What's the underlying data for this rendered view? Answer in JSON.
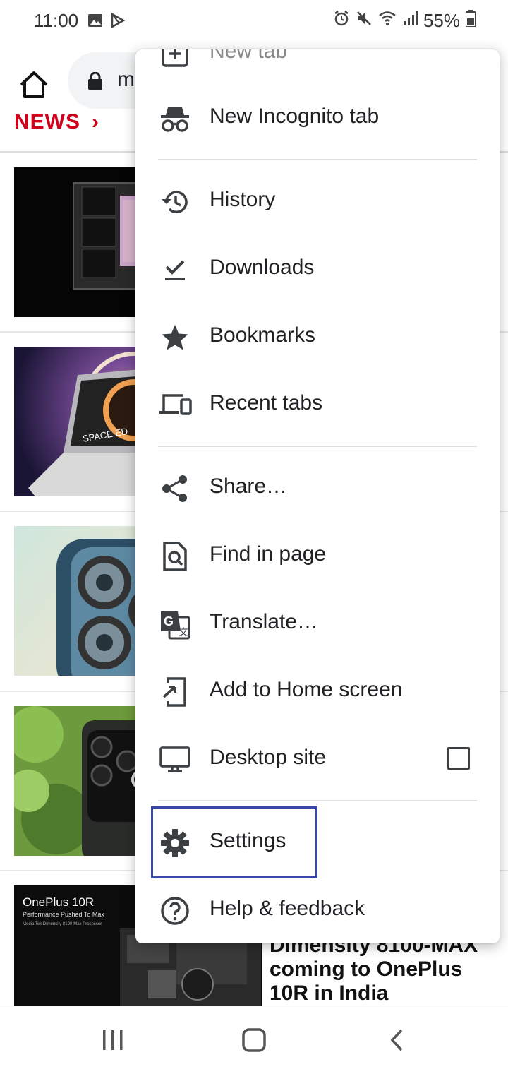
{
  "status_bar": {
    "time": "11:00",
    "battery": "55%",
    "left_icons": [
      "image-notification-icon",
      "play-store-icon"
    ],
    "right_icons": [
      "alarm-icon",
      "mute-icon",
      "wifi-icon",
      "signal-icon",
      "battery-icon"
    ]
  },
  "toolbar": {
    "url_visible": "m"
  },
  "page": {
    "section_title": "NEWS",
    "headline_lines": [
      "Dimensity 8100-MAX",
      "coming to OnePlus",
      "10R in India"
    ],
    "thumb_text": {
      "brand": "OnePlus 10R",
      "tagline": "Performance Pushed To Max",
      "sub": "Media Tek Dimensity 8100-Max Processor",
      "laptop": "SPACE ED"
    }
  },
  "menu": {
    "items": [
      {
        "id": "new-tab",
        "label": "New tab",
        "icon": "new-tab-icon"
      },
      {
        "id": "new-incognito-tab",
        "label": "New Incognito tab",
        "icon": "incognito-icon"
      },
      {
        "id": "history",
        "label": "History",
        "icon": "history-icon"
      },
      {
        "id": "downloads",
        "label": "Downloads",
        "icon": "downloads-icon"
      },
      {
        "id": "bookmarks",
        "label": "Bookmarks",
        "icon": "star-icon"
      },
      {
        "id": "recent-tabs",
        "label": "Recent tabs",
        "icon": "devices-icon"
      },
      {
        "id": "share",
        "label": "Share…",
        "icon": "share-icon"
      },
      {
        "id": "find-in-page",
        "label": "Find in page",
        "icon": "find-in-page-icon"
      },
      {
        "id": "translate",
        "label": "Translate…",
        "icon": "translate-icon"
      },
      {
        "id": "add-to-home-screen",
        "label": "Add to Home screen",
        "icon": "add-to-home-icon"
      },
      {
        "id": "desktop-site",
        "label": "Desktop site",
        "icon": "desktop-icon",
        "checkbox_checked": false
      },
      {
        "id": "settings",
        "label": "Settings",
        "icon": "gear-icon",
        "highlighted": true
      },
      {
        "id": "help-feedback",
        "label": "Help & feedback",
        "icon": "help-icon"
      }
    ]
  },
  "nav_bar": {
    "buttons": [
      "recent-apps-icon",
      "home-icon",
      "back-icon"
    ]
  },
  "colors": {
    "news_red": "#d0021b",
    "focus_ring": "#3949ab",
    "icon_gray": "#3c4043"
  }
}
